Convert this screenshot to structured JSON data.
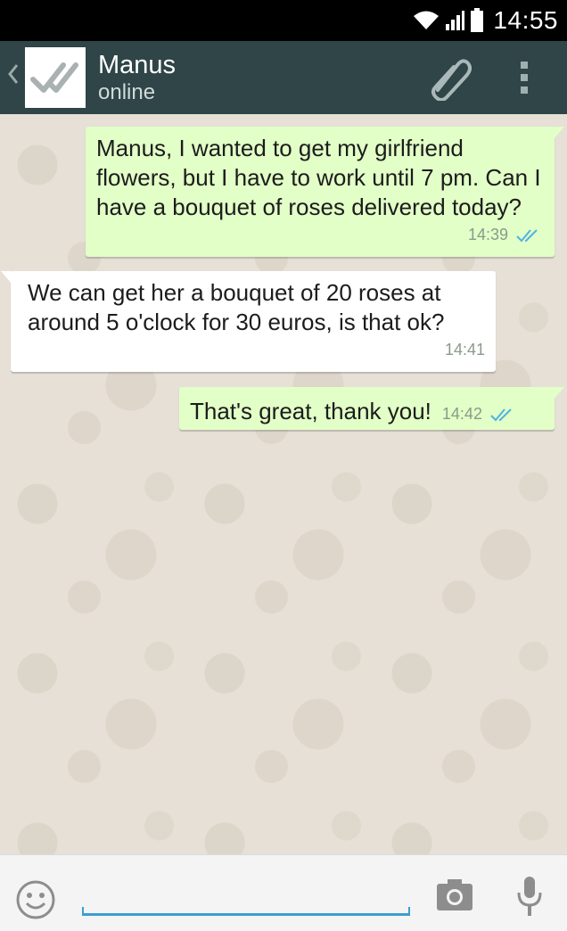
{
  "status_bar": {
    "time": "14:55",
    "icons": [
      "wifi-icon",
      "signal-icon",
      "battery-icon"
    ]
  },
  "header": {
    "back_icon": "chevron-left-icon",
    "contact_name": "Manus",
    "contact_status": "online",
    "avatar_icon": "double-check-icon",
    "actions": [
      "attach-icon",
      "overflow-menu-icon"
    ]
  },
  "messages": [
    {
      "direction": "outgoing",
      "text": "Manus, I wanted to get my girlfriend flowers, but I have to work until 7 pm. Can I have a bouquet of roses delivered today?",
      "time": "14:39",
      "read_receipt": "read"
    },
    {
      "direction": "incoming",
      "text": "We can get her a bouquet of 20 roses at around 5 o'clock for 30 euros, is that ok?",
      "time": "14:41"
    },
    {
      "direction": "outgoing",
      "text": "That's great, thank you!",
      "time": "14:42",
      "read_receipt": "read"
    }
  ],
  "input_bar": {
    "placeholder": "",
    "icons": [
      "emoji-icon",
      "camera-icon",
      "microphone-icon"
    ]
  },
  "colors": {
    "header_bg": "#2f4547",
    "outgoing_bubble": "#e2ffc7",
    "incoming_bubble": "#ffffff",
    "chat_bg": "#e6e0d6",
    "read_check": "#4fb2e3",
    "input_underline": "#3c9dd0"
  }
}
